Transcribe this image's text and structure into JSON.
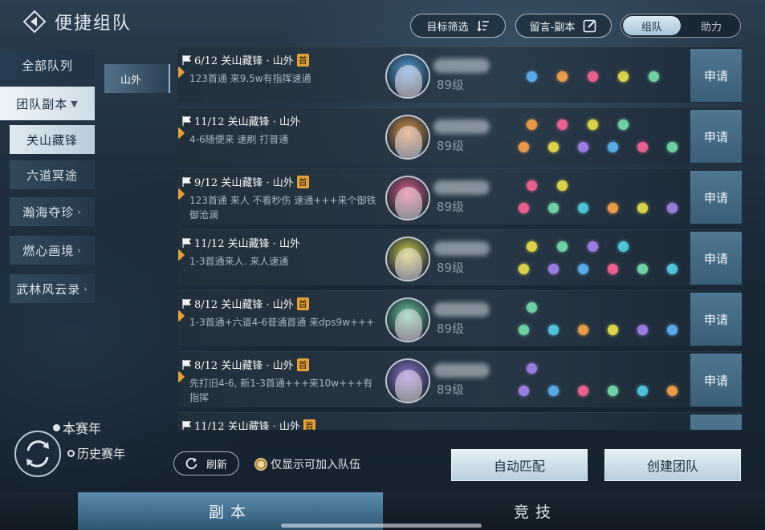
{
  "title": "便捷组队",
  "header": {
    "filter_label": "目标筛选",
    "comment_label": "留言-副本",
    "toggle": [
      "组队",
      "助力"
    ]
  },
  "nav": {
    "items": [
      "全部队列",
      "团队副本",
      "关山藏锋",
      "六道冥途",
      "瀚海夺珍",
      "燃心画境",
      "武林风云录"
    ],
    "region": "山外"
  },
  "teams": [
    {
      "title": "6/12 关山藏锋 · 山外",
      "first": "首",
      "note": "123首通 来9.5w有指挥速通",
      "level": "89级",
      "apply": "申请"
    },
    {
      "title": "11/12 关山藏锋 · 山外",
      "first": "",
      "note": "4-6随便来 速刷 打普通",
      "level": "89级",
      "apply": "申请"
    },
    {
      "title": "9/12 关山藏锋 · 山外",
      "first": "首",
      "note": "123首通  来人 不看秒伤 速通+++来个御铁  御沧澜",
      "level": "89级",
      "apply": "申请"
    },
    {
      "title": "11/12 关山藏锋 · 山外",
      "first": "",
      "note": "1-3首通来人. 来人速通",
      "level": "89级",
      "apply": "申请"
    },
    {
      "title": "8/12 关山藏锋 · 山外",
      "first": "首",
      "note": "1-3首通+六道4-6普通首通 来dps9w+++",
      "level": "89级",
      "apply": "申请"
    },
    {
      "title": "8/12 关山藏锋 · 山外",
      "first": "首",
      "note": "先打旧4-6, 新1-3首通+++来10w+++有指挥",
      "level": "89级",
      "apply": "申请"
    },
    {
      "title": "11/12 关山藏锋 · 山外",
      "first": "首",
      "note": "",
      "level": "",
      "apply": "申请"
    }
  ],
  "season": {
    "current": "本赛年",
    "history": "历史赛年"
  },
  "bottom": {
    "refresh": "刷新",
    "only_joinable": "仅显示可加入队伍",
    "auto_match": "自动匹配",
    "create_team": "创建团队"
  },
  "tabs": [
    "副本",
    "竞技"
  ],
  "colors": {
    "accent": "#e3a33a",
    "selected": "#dfe9f1",
    "button": "#4f7791"
  }
}
